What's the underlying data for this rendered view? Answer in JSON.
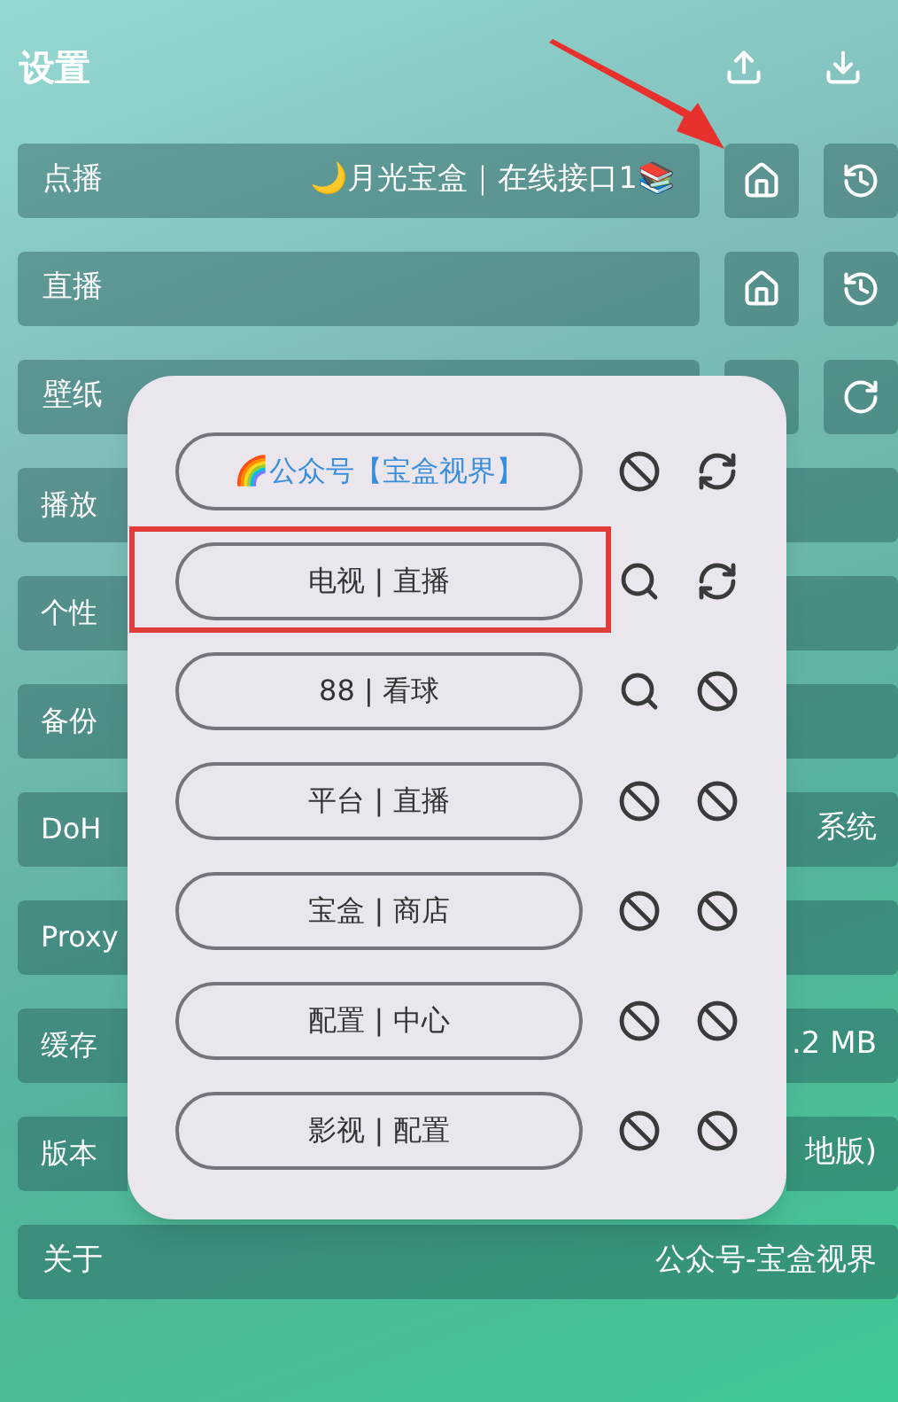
{
  "header": {
    "title": "设置"
  },
  "settings": [
    {
      "label": "点播",
      "value": "🌙月光宝盒｜在线接口1📚",
      "buttons": [
        {
          "kind": "home"
        },
        {
          "kind": "history"
        }
      ]
    },
    {
      "label": "直播",
      "buttons": [
        {
          "kind": "home"
        },
        {
          "kind": "history"
        }
      ]
    },
    {
      "label": "壁纸",
      "buttons": [
        {
          "kind": "covered"
        },
        {
          "kind": "refresh"
        }
      ]
    },
    {
      "label": "播放"
    },
    {
      "label": "个性"
    },
    {
      "label": "备份"
    },
    {
      "label": "DoH",
      "value": "系统"
    },
    {
      "label": "Proxy"
    },
    {
      "label": "缓存",
      "value": ".2 MB"
    },
    {
      "label": "版本",
      "value": "地版)"
    },
    {
      "label": "关于",
      "value": "公众号-宝盒视界"
    }
  ],
  "dialog": {
    "items": [
      {
        "label": "🌈公众号【宝盒视界】",
        "color": "#3a8fdc",
        "actions": [
          {
            "kind": "block"
          },
          {
            "kind": "sync"
          }
        ]
      },
      {
        "label": "电视 | 直播",
        "color": "#333333",
        "actions": [
          {
            "kind": "search"
          },
          {
            "kind": "sync"
          }
        ]
      },
      {
        "label": "88 | 看球",
        "color": "#333333",
        "actions": [
          {
            "kind": "search"
          },
          {
            "kind": "block"
          }
        ]
      },
      {
        "label": "平台 | 直播",
        "color": "#333333",
        "actions": [
          {
            "kind": "block"
          },
          {
            "kind": "block"
          }
        ]
      },
      {
        "label": "宝盒 | 商店",
        "color": "#333333",
        "actions": [
          {
            "kind": "block"
          },
          {
            "kind": "block"
          }
        ]
      },
      {
        "label": "配置 | 中心",
        "color": "#333333",
        "actions": [
          {
            "kind": "block"
          },
          {
            "kind": "block"
          }
        ]
      },
      {
        "label": "影视 | 配置",
        "color": "#333333",
        "actions": [
          {
            "kind": "block"
          },
          {
            "kind": "block"
          }
        ]
      }
    ]
  }
}
